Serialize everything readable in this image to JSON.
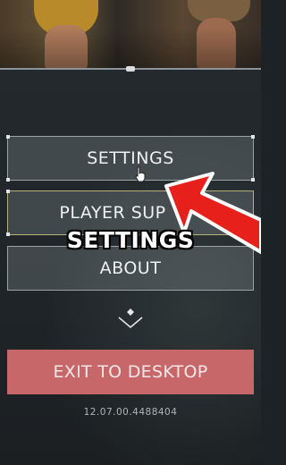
{
  "menu": {
    "settings_label": "SETTINGS",
    "support_label": "PLAYER SUP",
    "about_label": "ABOUT",
    "exit_label": "EXIT TO DESKTOP"
  },
  "overlay": {
    "caption": "SETTINGS"
  },
  "footer": {
    "version": "12.07.00.4488404"
  },
  "icons": {
    "expand": "chevron-down-icon",
    "pointer": "hand-cursor-icon",
    "annotation": "red-arrow-icon"
  },
  "colors": {
    "exit_button": "#c8676a",
    "arrow": "#e8201c",
    "panel": "#1f2428"
  }
}
